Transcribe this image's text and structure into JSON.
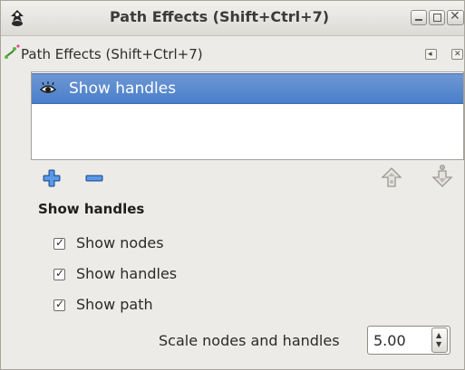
{
  "window": {
    "title": "Path Effects  (Shift+Ctrl+7)",
    "app_icon": "inkscape-icon",
    "controls": [
      "minimize-icon",
      "maximize-icon",
      "close-icon"
    ]
  },
  "dock": {
    "title": "Path Effects  (Shift+Ctrl+7)",
    "icon": "path-effects-icon"
  },
  "effect_list": {
    "items": [
      {
        "label": "Show handles",
        "visible_icon": "eye-icon",
        "selected": true
      }
    ]
  },
  "toolbar": {
    "add": "plus-icon",
    "remove": "minus-icon",
    "raise": "arrow-up-icon",
    "lower": "arrow-down-icon"
  },
  "settings": {
    "section_title": "Show handles",
    "options": [
      {
        "label": "Show nodes",
        "checked": true
      },
      {
        "label": "Show handles",
        "checked": true
      },
      {
        "label": "Show path",
        "checked": true
      }
    ],
    "scale": {
      "label": "Scale nodes and handles",
      "value": "5.00"
    }
  },
  "colors": {
    "selection": "#4a7fcb",
    "accent_plus": "#3b7ad6"
  }
}
